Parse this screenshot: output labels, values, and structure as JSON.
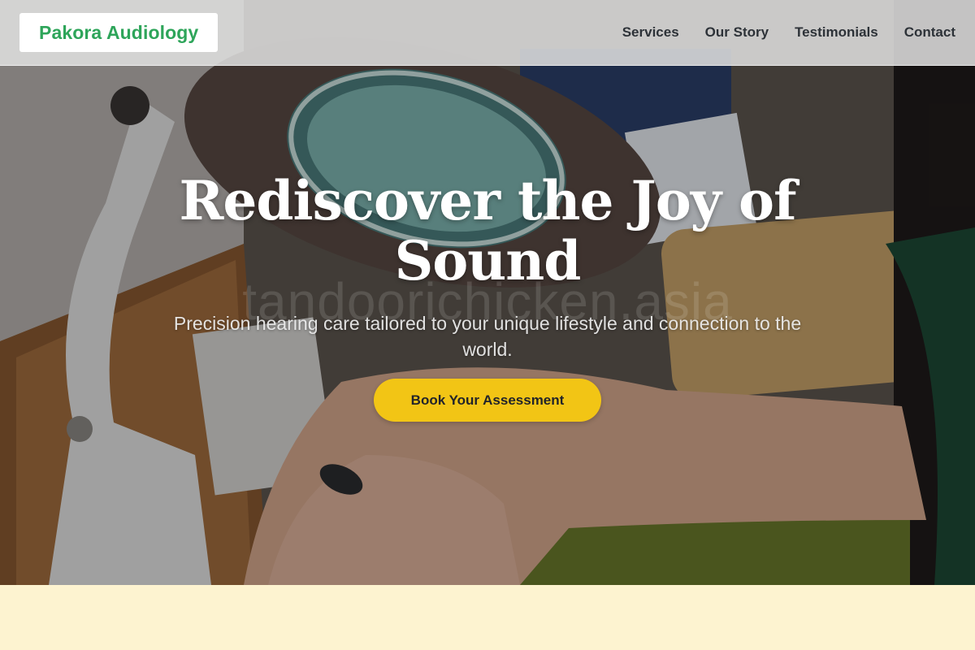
{
  "brand": {
    "name": "Pakora Audiology",
    "color": "#2ea55a"
  },
  "nav": {
    "items": [
      {
        "label": "Services"
      },
      {
        "label": "Our Story"
      },
      {
        "label": "Testimonials"
      },
      {
        "label": "Contact"
      }
    ]
  },
  "hero": {
    "title": "Rediscover the Joy of Sound",
    "subtitle": "Precision hearing care tailored to your unique lifestyle and connection to the world.",
    "cta_label": "Book Your Assessment",
    "cta_color": "#f2c515",
    "watermark": "tandoorichicken.asia",
    "image_subject": "magnifying-lamp-hearing-aid-repair-photo"
  },
  "colors": {
    "section_bg": "#fdf3d0",
    "nav_text": "#2d3238"
  }
}
